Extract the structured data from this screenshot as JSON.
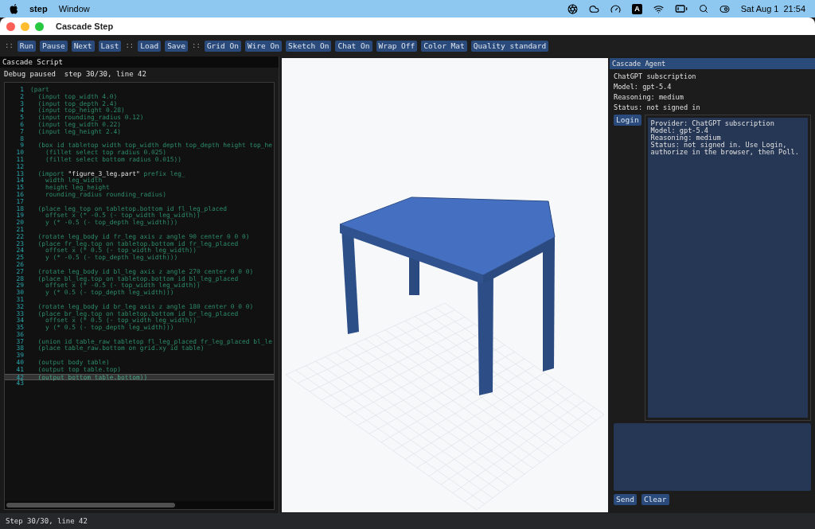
{
  "menu_bar": {
    "app": "step",
    "menus": [
      "Window"
    ],
    "input_badge": "A",
    "date": "Sat Aug 1",
    "time": "21:54"
  },
  "window": {
    "title": "Cascade Step"
  },
  "toolbar": [
    {
      "kind": "separator",
      "label": "::"
    },
    {
      "kind": "button",
      "label": "Run"
    },
    {
      "kind": "button",
      "label": "Pause"
    },
    {
      "kind": "button",
      "label": "Next"
    },
    {
      "kind": "button",
      "label": "Last"
    },
    {
      "kind": "separator",
      "label": "::"
    },
    {
      "kind": "button",
      "label": "Load"
    },
    {
      "kind": "button",
      "label": "Save"
    },
    {
      "kind": "separator",
      "label": "::"
    },
    {
      "kind": "button",
      "label": "Grid On"
    },
    {
      "kind": "button",
      "label": "Wire On"
    },
    {
      "kind": "button",
      "label": "Sketch On"
    },
    {
      "kind": "button",
      "label": "Chat On"
    },
    {
      "kind": "button",
      "label": "Wrap Off"
    },
    {
      "kind": "button",
      "label": "Color Mat"
    },
    {
      "kind": "button",
      "label": "Quality standard"
    }
  ],
  "script_panel": {
    "title": "Cascade Script",
    "debug_status": "Debug paused  step 30/30, line 42",
    "lines": [
      {
        "number": "1",
        "text": "(part",
        "selected": false
      },
      {
        "number": "2",
        "text": "  (input top_width 4.0)",
        "selected": false
      },
      {
        "number": "3",
        "text": "  (input top_depth 2.4)",
        "selected": false
      },
      {
        "number": "4",
        "text": "  (input top_height 0.28)",
        "selected": false
      },
      {
        "number": "5",
        "text": "  (input rounding_radius 0.12)",
        "selected": false
      },
      {
        "number": "6",
        "text": "  (input leg_width 0.22)",
        "selected": false
      },
      {
        "number": "7",
        "text": "  (input leg_height 2.4)",
        "selected": false
      },
      {
        "number": "8",
        "selected": false
      },
      {
        "number": "9",
        "text": "  (box id tabletop width top_width depth top_depth height top_he",
        "selected": false
      },
      {
        "number": "10",
        "text": "    (fillet select top radius 0.025)",
        "selected": false
      },
      {
        "number": "11",
        "text": "    (fillet select bottom radius 0.015))",
        "selected": false
      },
      {
        "number": "12",
        "selected": false
      },
      {
        "number": "13",
        "parts": [
          {
            "kind": "code",
            "text": "  (import "
          },
          {
            "kind": "string",
            "text": "\"figure_3_leg.part\""
          },
          {
            "kind": "code",
            "text": " prefix leg_"
          }
        ],
        "selected": false
      },
      {
        "number": "14",
        "text": "    width leg_width",
        "selected": false
      },
      {
        "number": "15",
        "text": "    height leg_height",
        "selected": false
      },
      {
        "number": "16",
        "text": "    rounding_radius rounding_radius)",
        "selected": false
      },
      {
        "number": "17",
        "selected": false
      },
      {
        "number": "18",
        "text": "  (place leg_top on tabletop.bottom id fl_leg_placed",
        "selected": false
      },
      {
        "number": "19",
        "text": "    offset x (* -0.5 (- top_width leg_width))",
        "selected": false
      },
      {
        "number": "20",
        "text": "    y (* -0.5 (- top_depth leg_width)))",
        "selected": false
      },
      {
        "number": "21",
        "selected": false
      },
      {
        "number": "22",
        "text": "  (rotate leg_body id fr_leg axis z angle 90 center 0 0 0)",
        "selected": false
      },
      {
        "number": "23",
        "text": "  (place fr_leg.top on tabletop.bottom id fr_leg_placed",
        "selected": false
      },
      {
        "number": "24",
        "text": "    offset x (* 0.5 (- top_width leg_width))",
        "selected": false
      },
      {
        "number": "25",
        "text": "    y (* -0.5 (- top_depth leg_width)))",
        "selected": false
      },
      {
        "number": "26",
        "selected": false
      },
      {
        "number": "27",
        "text": "  (rotate leg_body id bl_leg axis z angle 270 center 0 0 0)",
        "selected": false
      },
      {
        "number": "28",
        "text": "  (place bl_leg.top on tabletop.bottom id bl_leg_placed",
        "selected": false
      },
      {
        "number": "29",
        "text": "    offset x (* -0.5 (- top_width leg_width))",
        "selected": false
      },
      {
        "number": "30",
        "text": "    y (* 0.5 (- top_depth leg_width)))",
        "selected": false
      },
      {
        "number": "31",
        "selected": false
      },
      {
        "number": "32",
        "text": "  (rotate leg_body id br_leg axis z angle 180 center 0 0 0)",
        "selected": false
      },
      {
        "number": "33",
        "text": "  (place br_leg.top on tabletop.bottom id br_leg_placed",
        "selected": false
      },
      {
        "number": "34",
        "text": "    offset x (* 0.5 (- top_width leg_width))",
        "selected": false
      },
      {
        "number": "35",
        "text": "    y (* 0.5 (- top_depth leg_width)))",
        "selected": false
      },
      {
        "number": "36",
        "selected": false
      },
      {
        "number": "37",
        "text": "  (union id table_raw tabletop fl_leg_placed fr_leg_placed bl_le",
        "selected": false
      },
      {
        "number": "38",
        "text": "  (place table_raw.bottom on grid.xy id table)",
        "selected": false
      },
      {
        "number": "39",
        "selected": false
      },
      {
        "number": "40",
        "text": "  (output body table)",
        "selected": false
      },
      {
        "number": "41",
        "text": "  (output top table.top)",
        "selected": false
      },
      {
        "number": "42",
        "text": "  (output bottom table.bottom))",
        "selected": true
      },
      {
        "number": "43",
        "selected": false
      }
    ]
  },
  "agent_panel": {
    "title": "Cascade Agent",
    "info": [
      "ChatGPT subscription",
      "Model: gpt-5.4",
      "Reasoning: medium",
      "Status: not signed in"
    ],
    "login_button": "Login",
    "log": [
      "Provider: ChatGPT subscription",
      "Model: gpt-5.4",
      "Reasoning: medium",
      "Status: not signed in. Use Login, authorize in the browser, then Poll."
    ],
    "buttons": [
      "Send",
      "Clear"
    ]
  },
  "status_bar": "Step 30/30, line 42"
}
